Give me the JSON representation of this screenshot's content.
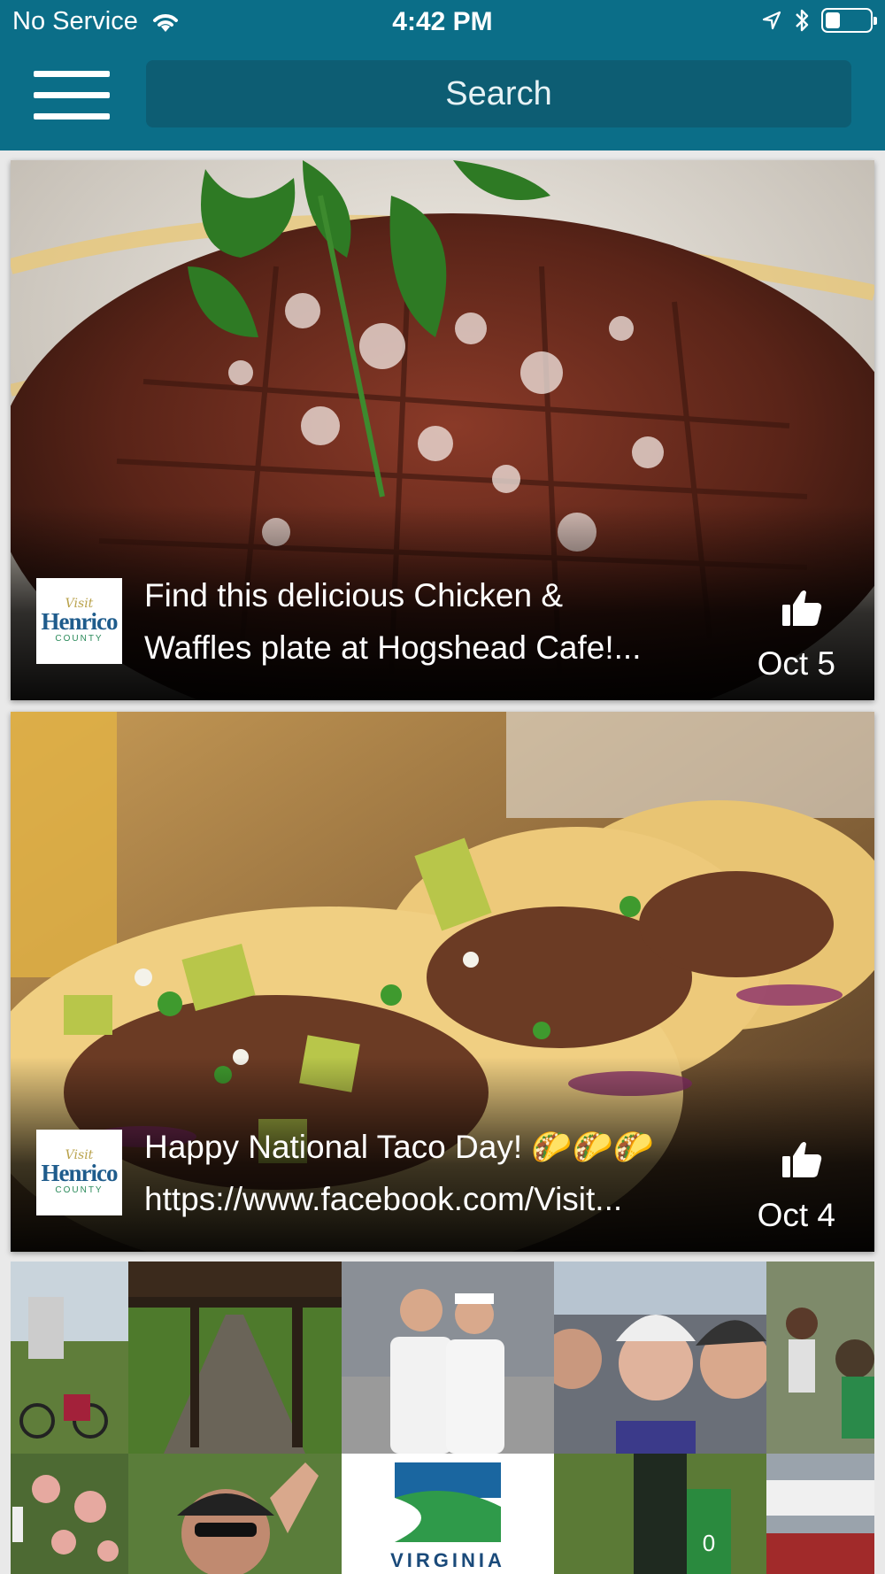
{
  "status_bar": {
    "carrier": "No Service",
    "time": "4:42 PM",
    "battery_level": 0.35
  },
  "header": {
    "menu_icon": "hamburger-menu-icon",
    "search_placeholder": "Search"
  },
  "feed": [
    {
      "source_logo": {
        "visit": "Visit",
        "name": "Henrico",
        "sub": "COUNTY"
      },
      "caption_line1": "Find this delicious Chicken &",
      "caption_line2": "Waffles plate at Hogshead Cafe!...",
      "like_icon": "thumbs-up-icon",
      "date": "Oct 5"
    },
    {
      "source_logo": {
        "visit": "Visit",
        "name": "Henrico",
        "sub": "COUNTY"
      },
      "caption_line1": "Happy National Taco Day! 🌮🌮🌮",
      "caption_line2": "https://www.facebook.com/Visit...",
      "like_icon": "thumbs-up-icon",
      "date": "Oct 4"
    }
  ],
  "collage_text": {
    "bottom_logo": "VIRGINIA",
    "sign_number": "0"
  },
  "colors": {
    "header": "#0b6e88",
    "search_field": "#0d5d73"
  }
}
